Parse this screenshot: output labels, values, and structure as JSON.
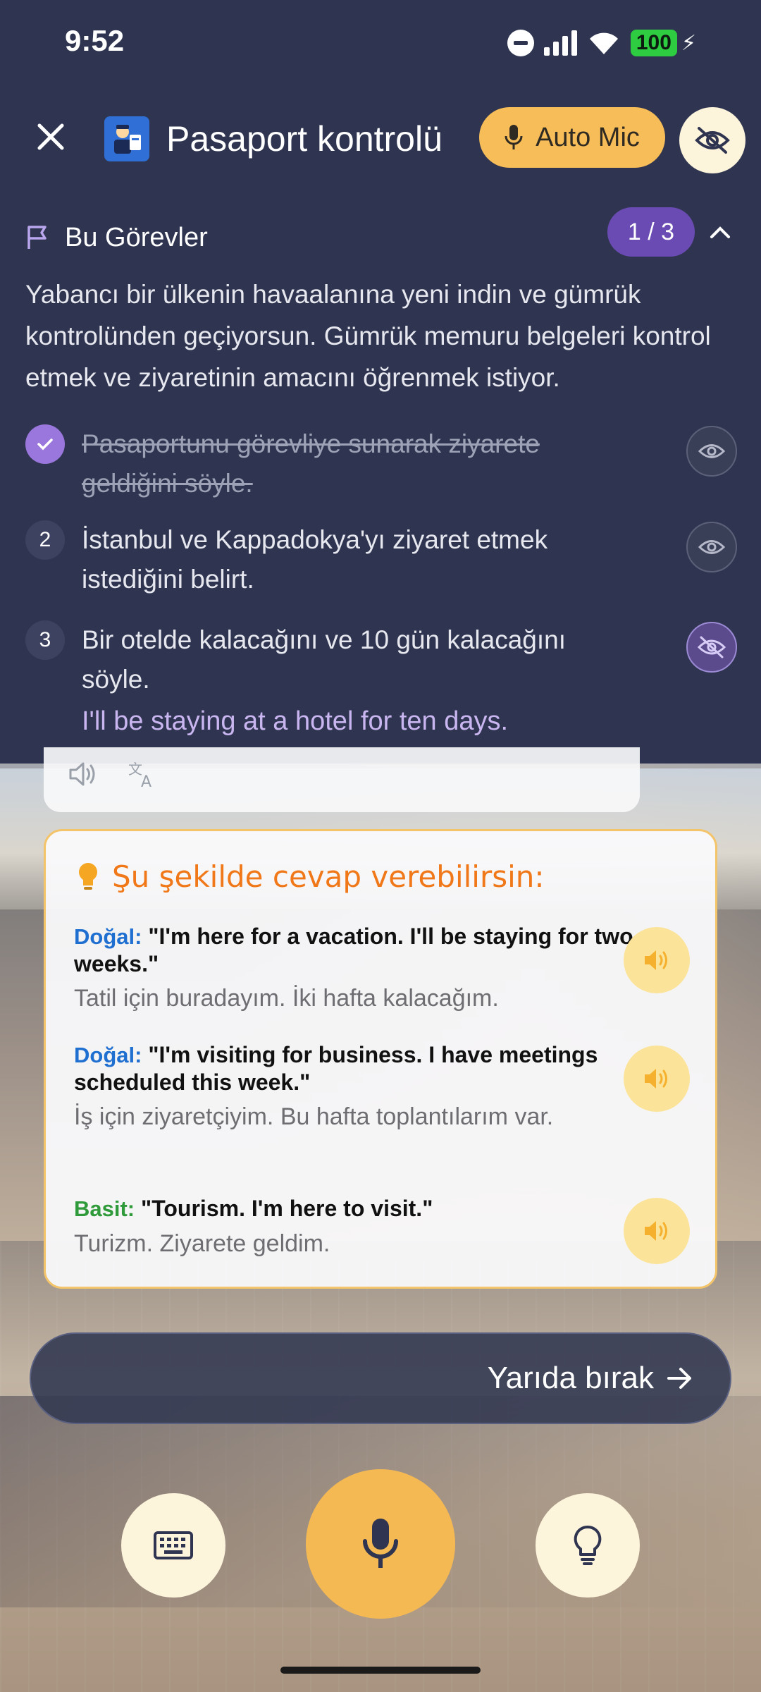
{
  "status": {
    "time": "9:52",
    "battery": "100"
  },
  "header": {
    "title": "Pasaport kontrolü",
    "auto_mic": "Auto Mic"
  },
  "tasks": {
    "title": "Bu Görevler",
    "counter": "1 / 3",
    "description": "Yabancı bir ülkenin havaalanına yeni indin ve gümrük kontrolünden geçiyorsun. Gümrük memuru belgeleri kontrol etmek ve ziyaretinin amacını öğrenmek istiyor.",
    "items": [
      {
        "number": "1",
        "text": "Pasaportunu görevliye sunarak ziyarete geldiğini söyle.",
        "done": true
      },
      {
        "number": "2",
        "text": "İstanbul ve Kappadokya'yı ziyaret etmek istediğini belirt.",
        "done": false
      },
      {
        "number": "3",
        "text": "Bir otelde kalacağını ve 10 gün kalacağını söyle.",
        "done": false
      }
    ],
    "hint": "I'll be staying at a hotel for ten days."
  },
  "suggestions": {
    "title": "Şu şekilde cevap verebilirsin:",
    "items": [
      {
        "tag": "Doğal:",
        "en": "\"I'm here for a vacation. I'll be staying for two weeks.\"",
        "tr": "Tatil için buradayım. İki hafta kalacağım."
      },
      {
        "tag": "Doğal:",
        "en": "\"I'm visiting for business. I have meetings scheduled this week.\"",
        "tr": "İş için ziyaretçiyim. Bu hafta toplantılarım var."
      },
      {
        "tag": "Basit:",
        "en": "\"Tourism. I'm here to visit.\"",
        "tr": "Turizm. Ziyarete geldim."
      }
    ]
  },
  "quit_label": "Yarıda bırak",
  "colors": {
    "accent": "#f7bd58",
    "purple": "#6a4bb3",
    "panel": "#2f3550",
    "orange_title": "#f07818"
  }
}
